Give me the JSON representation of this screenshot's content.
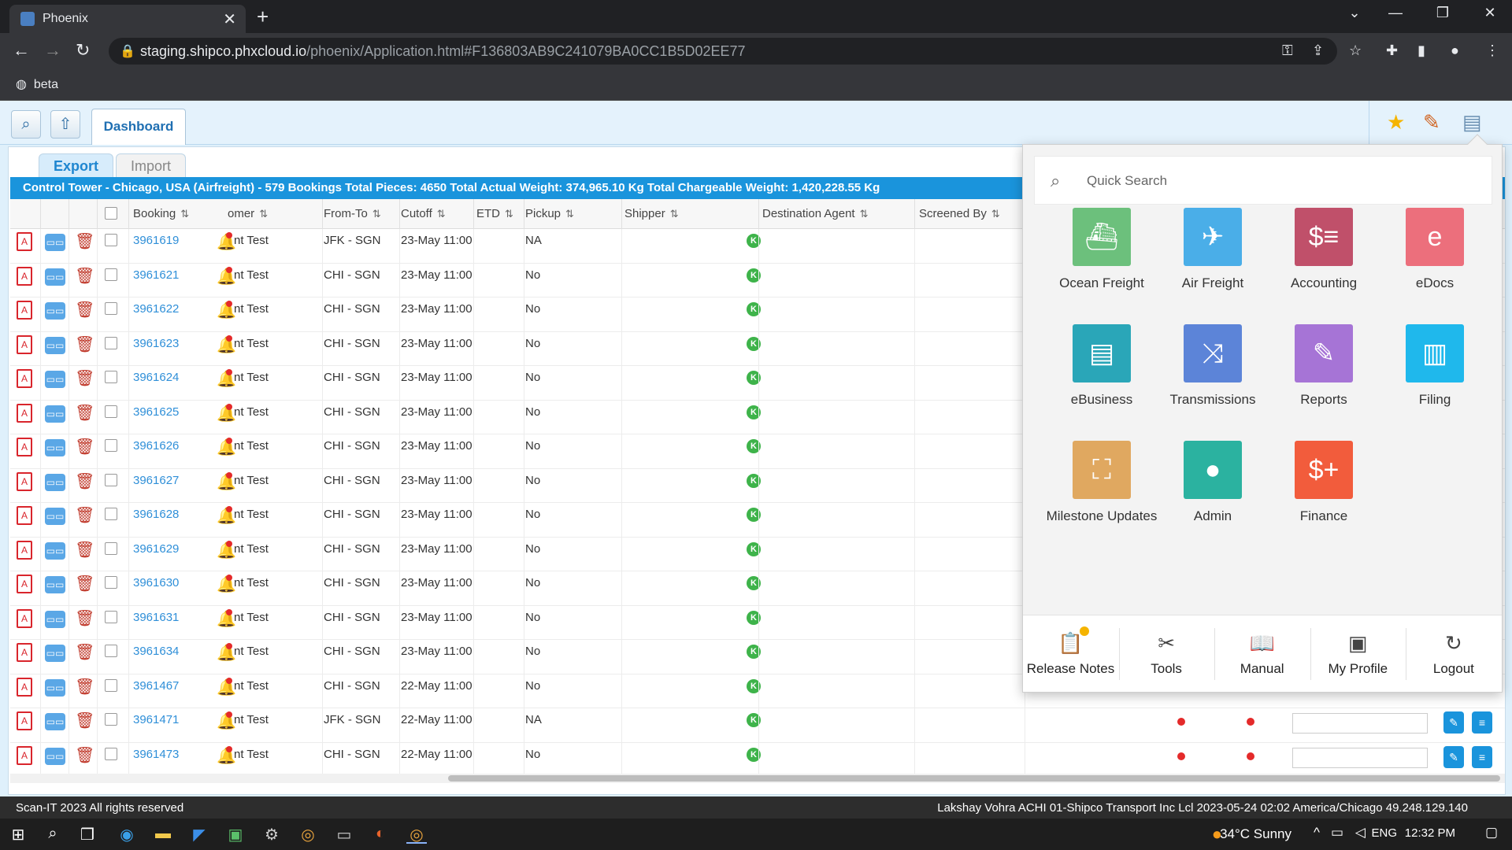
{
  "browser": {
    "tab_title": "Phoenix",
    "tab_close": "✕",
    "new_tab": "+",
    "url_host": "staging.shipco.phxcloud.io",
    "url_path": "/phoenix/Application.html#F136803AB9C241079BA0CC1B5D02EE77",
    "bookmark": "beta"
  },
  "app": {
    "dashboard_tab": "Dashboard",
    "subtabs": {
      "export": "Export",
      "import": "Import"
    },
    "summary": "Control Tower - Chicago, USA (Airfreight) - 579 Bookings Total Pieces: 4650 Total Actual Weight: 374,965.10 Kg Total Chargeable Weight: 1,420,228.55 Kg",
    "columns": {
      "booking": "Booking",
      "customer": "omer",
      "from_to": "From-To",
      "cutoff": "Cutoff",
      "etd": "ETD",
      "pickup": "Pickup",
      "shipper": "Shipper",
      "destination_agent": "Destination Agent",
      "screened_by": "Screened By"
    },
    "sort_icon": "⇅",
    "badge_letter": "K",
    "rows": [
      {
        "booking": "3961619",
        "customer": "nt Test",
        "from_to": "JFK - SGN",
        "cutoff": "23-May 11:00",
        "pickup": "NA"
      },
      {
        "booking": "3961621",
        "customer": "nt Test",
        "from_to": "CHI - SGN",
        "cutoff": "23-May 11:00",
        "pickup": "No"
      },
      {
        "booking": "3961622",
        "customer": "nt Test",
        "from_to": "CHI - SGN",
        "cutoff": "23-May 11:00",
        "pickup": "No"
      },
      {
        "booking": "3961623",
        "customer": "nt Test",
        "from_to": "CHI - SGN",
        "cutoff": "23-May 11:00",
        "pickup": "No"
      },
      {
        "booking": "3961624",
        "customer": "nt Test",
        "from_to": "CHI - SGN",
        "cutoff": "23-May 11:00",
        "pickup": "No"
      },
      {
        "booking": "3961625",
        "customer": "nt Test",
        "from_to": "CHI - SGN",
        "cutoff": "23-May 11:00",
        "pickup": "No"
      },
      {
        "booking": "3961626",
        "customer": "nt Test",
        "from_to": "CHI - SGN",
        "cutoff": "23-May 11:00",
        "pickup": "No"
      },
      {
        "booking": "3961627",
        "customer": "nt Test",
        "from_to": "CHI - SGN",
        "cutoff": "23-May 11:00",
        "pickup": "No"
      },
      {
        "booking": "3961628",
        "customer": "nt Test",
        "from_to": "CHI - SGN",
        "cutoff": "23-May 11:00",
        "pickup": "No"
      },
      {
        "booking": "3961629",
        "customer": "nt Test",
        "from_to": "CHI - SGN",
        "cutoff": "23-May 11:00",
        "pickup": "No"
      },
      {
        "booking": "3961630",
        "customer": "nt Test",
        "from_to": "CHI - SGN",
        "cutoff": "23-May 11:00",
        "pickup": "No"
      },
      {
        "booking": "3961631",
        "customer": "nt Test",
        "from_to": "CHI - SGN",
        "cutoff": "23-May 11:00",
        "pickup": "No"
      },
      {
        "booking": "3961634",
        "customer": "nt Test",
        "from_to": "CHI - SGN",
        "cutoff": "23-May 11:00",
        "pickup": "No"
      },
      {
        "booking": "3961467",
        "customer": "nt Test",
        "from_to": "CHI - SGN",
        "cutoff": "22-May 11:00",
        "pickup": "No"
      },
      {
        "booking": "3961471",
        "customer": "nt Test",
        "from_to": "JFK - SGN",
        "cutoff": "22-May 11:00",
        "pickup": "NA"
      },
      {
        "booking": "3961473",
        "customer": "nt Test",
        "from_to": "CHI - SGN",
        "cutoff": "22-May 11:00",
        "pickup": "No"
      }
    ]
  },
  "menu": {
    "search_placeholder": "Quick Search",
    "tiles": [
      {
        "label": "Ocean Freight",
        "color": "#6cc07c",
        "icon": "ship-icon"
      },
      {
        "label": "Air Freight",
        "color": "#4aaee8",
        "icon": "plane-icon"
      },
      {
        "label": "Accounting",
        "color": "#c0506a",
        "icon": "invoice-icon"
      },
      {
        "label": "eDocs",
        "color": "#ec6f7c",
        "icon": "edocs-icon"
      },
      {
        "label": "eBusiness",
        "color": "#2aa6b8",
        "icon": "ebusiness-icon"
      },
      {
        "label": "Transmissions",
        "color": "#5c84d8",
        "icon": "shuffle-icon"
      },
      {
        "label": "Reports",
        "color": "#a674d6",
        "icon": "edit-report-icon"
      },
      {
        "label": "Filing",
        "color": "#1fb8ec",
        "icon": "filing-icon"
      },
      {
        "label": "Milestone Updates",
        "color": "#e0a860",
        "icon": "presentation-icon"
      },
      {
        "label": "Admin",
        "color": "#2bb2a0",
        "icon": "user-icon"
      },
      {
        "label": "Finance",
        "color": "#f25c3c",
        "icon": "finance-icon"
      }
    ],
    "footer": [
      {
        "label": "Release Notes",
        "icon": "clipboard-icon"
      },
      {
        "label": "Tools",
        "icon": "tools-icon"
      },
      {
        "label": "Manual",
        "icon": "book-icon"
      },
      {
        "label": "My Profile",
        "icon": "profile-card-icon"
      },
      {
        "label": "Logout",
        "icon": "logout-icon"
      }
    ]
  },
  "status": {
    "left": "Scan-IT 2023 All rights reserved",
    "right": "Lakshay Vohra ACHI 01-Shipco Transport Inc Lcl 2023-05-24 02:02 America/Chicago 49.248.129.140"
  },
  "taskbar": {
    "weather": "34°C Sunny",
    "lang": "ENG",
    "time": "12:32 PM"
  }
}
